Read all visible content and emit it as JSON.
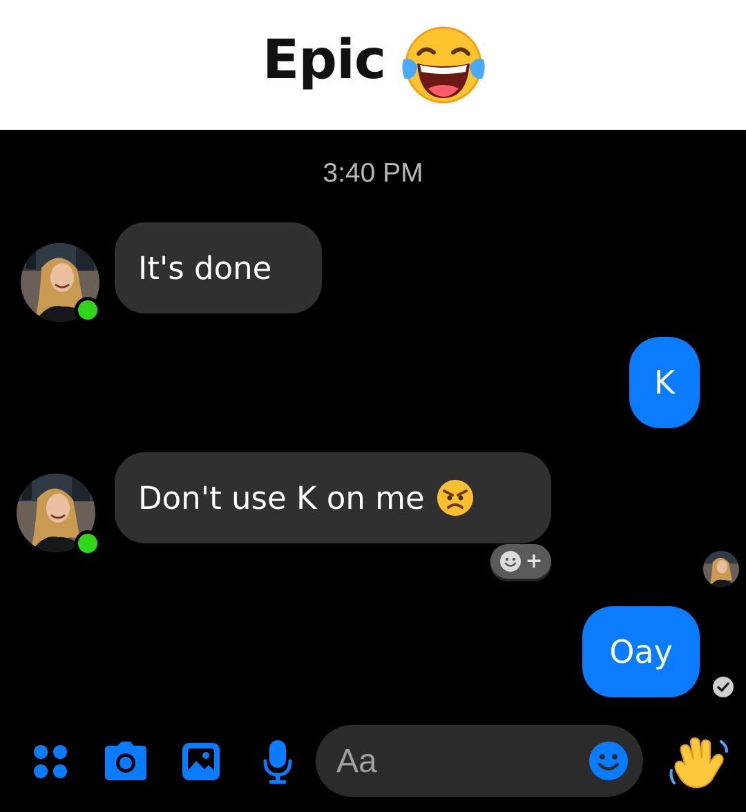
{
  "caption": {
    "title": "Epic",
    "emoji": "face-with-tears-of-joy-emoji"
  },
  "conversation": {
    "timestamp": "3:40 PM",
    "messages": [
      {
        "direction": "incoming",
        "text": "It's done"
      },
      {
        "direction": "outgoing",
        "text": "K"
      },
      {
        "direction": "incoming",
        "text": "Don't use K on me",
        "emoji": "angry-face-emoji"
      },
      {
        "direction": "outgoing",
        "text": "Oay"
      }
    ],
    "contact_status": "online"
  },
  "composer": {
    "placeholder": "Aa",
    "actions": [
      "menu-dots-icon",
      "camera-icon",
      "gallery-icon",
      "microphone-icon",
      "emoji-icon",
      "waving-hand-icon"
    ]
  },
  "colors": {
    "background": "#000000",
    "incoming_bubble": "#303030",
    "outgoing_bubble": "#0a7cff",
    "accent": "#0a7cff",
    "online": "#31d61a",
    "timestamp": "#b8b8b8"
  }
}
